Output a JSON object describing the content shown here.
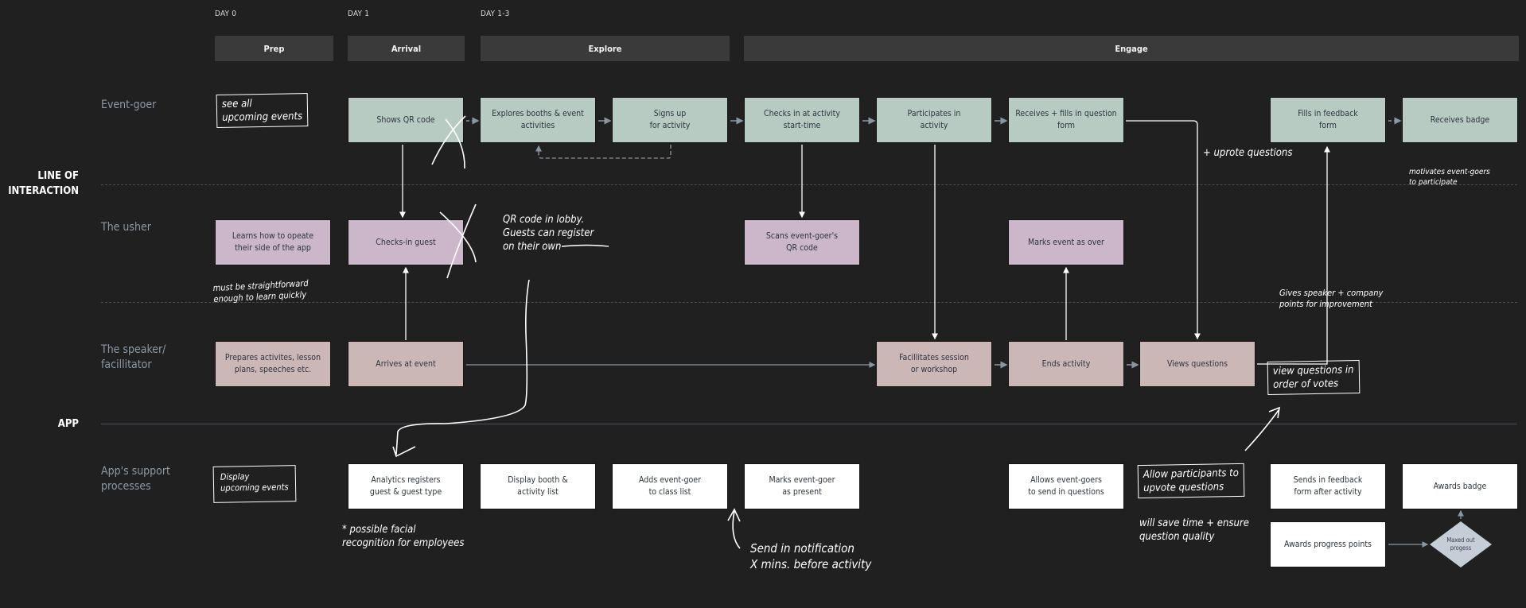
{
  "days": [
    "DAY 0",
    "DAY 1",
    "DAY 1-3"
  ],
  "phases": [
    "Prep",
    "Arrival",
    "Explore",
    "Engage"
  ],
  "sections": {
    "line_of_interaction": "LINE OF\nINTERACTION",
    "app": "APP"
  },
  "lanes": {
    "event_goer": "Event-goer",
    "usher": "The usher",
    "speaker": "The speaker/\nfacillitator",
    "support": "App's support\nprocesses"
  },
  "event_goer_steps": [
    "Shows QR code",
    "Explores booths & event activities",
    "Signs up\nfor activity",
    "Checks in at activity\nstart-time",
    "Participates in\nactivity",
    "Receives + fills in question form",
    "Fills in feedback\nform",
    "Receives badge"
  ],
  "usher_steps": [
    "Learns how to opeate\ntheir side of the app",
    "Checks-in guest",
    "Scans event-goer's\nQR code",
    "Marks event as over"
  ],
  "speaker_steps": [
    "Prepares activites, lesson plans, speeches etc.",
    "Arrives at event",
    "Facillitates session\nor workshop",
    "Ends activity",
    "Views questions"
  ],
  "support_steps": [
    "Analytics registers\nguest & guest type",
    "Display booth &\nactivity list",
    "Adds event-goer\nto class list",
    "Marks event-goer\nas present",
    "Allows event-goers\nto send in questions",
    "Sends in feedback\nform after activity",
    "Awards badge",
    "Awards progress points"
  ],
  "decision": "Maxed out\nprogess",
  "annotations": {
    "see_all": "see all\nupcoming events",
    "straightforward": "must be straightforward\nenough to learn quickly",
    "qr_lobby": "QR code in lobby.\nGuests can register\non their own",
    "uprote": "+ uprote questions",
    "motivates": "motivates event-goers\nto participate",
    "gives_speaker": "Gives speaker + company\npoints for improvement",
    "view_votes": "view questions in\norder of votes",
    "display_upcoming": "Display\nupcoming events",
    "facial": "* possible facial\nrecognition for employees",
    "notification": "Send in notification\nX mins. before activity",
    "allow_upvote": "Allow participants to\nupvote questions",
    "save_time": "will save time + ensure\nquestion quality"
  }
}
